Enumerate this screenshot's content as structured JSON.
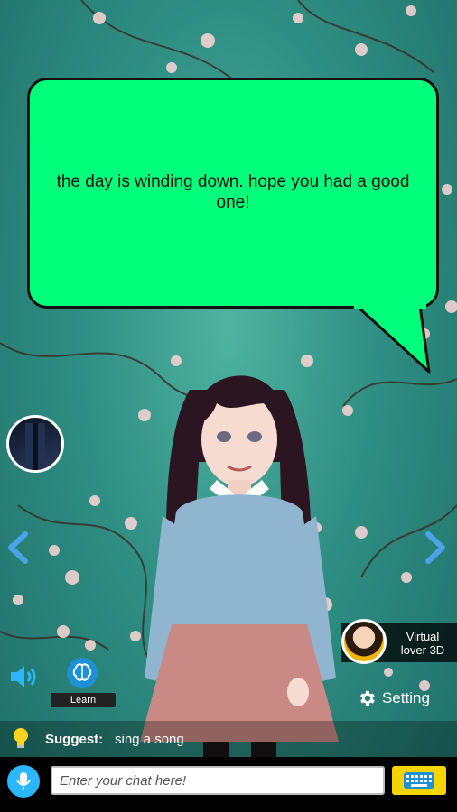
{
  "speech_bubble": {
    "text": "the day is winding down. hope you had a good one!"
  },
  "nav": {
    "prev_icon": "chevron-left-icon",
    "next_icon": "chevron-right-icon"
  },
  "promo": {
    "label_line1": "Virtual",
    "label_line2": "lover 3D"
  },
  "controls": {
    "learn_label": "Learn",
    "setting_label": "Setting"
  },
  "suggest": {
    "label": "Suggest:",
    "value": "sing a song"
  },
  "chat": {
    "placeholder": "Enter your chat here!"
  },
  "colors": {
    "bubble": "#00ff7a",
    "accent_blue": "#2bb7ff",
    "keyboard_yellow": "#f6d400",
    "background_teal": "#2f8f83"
  }
}
